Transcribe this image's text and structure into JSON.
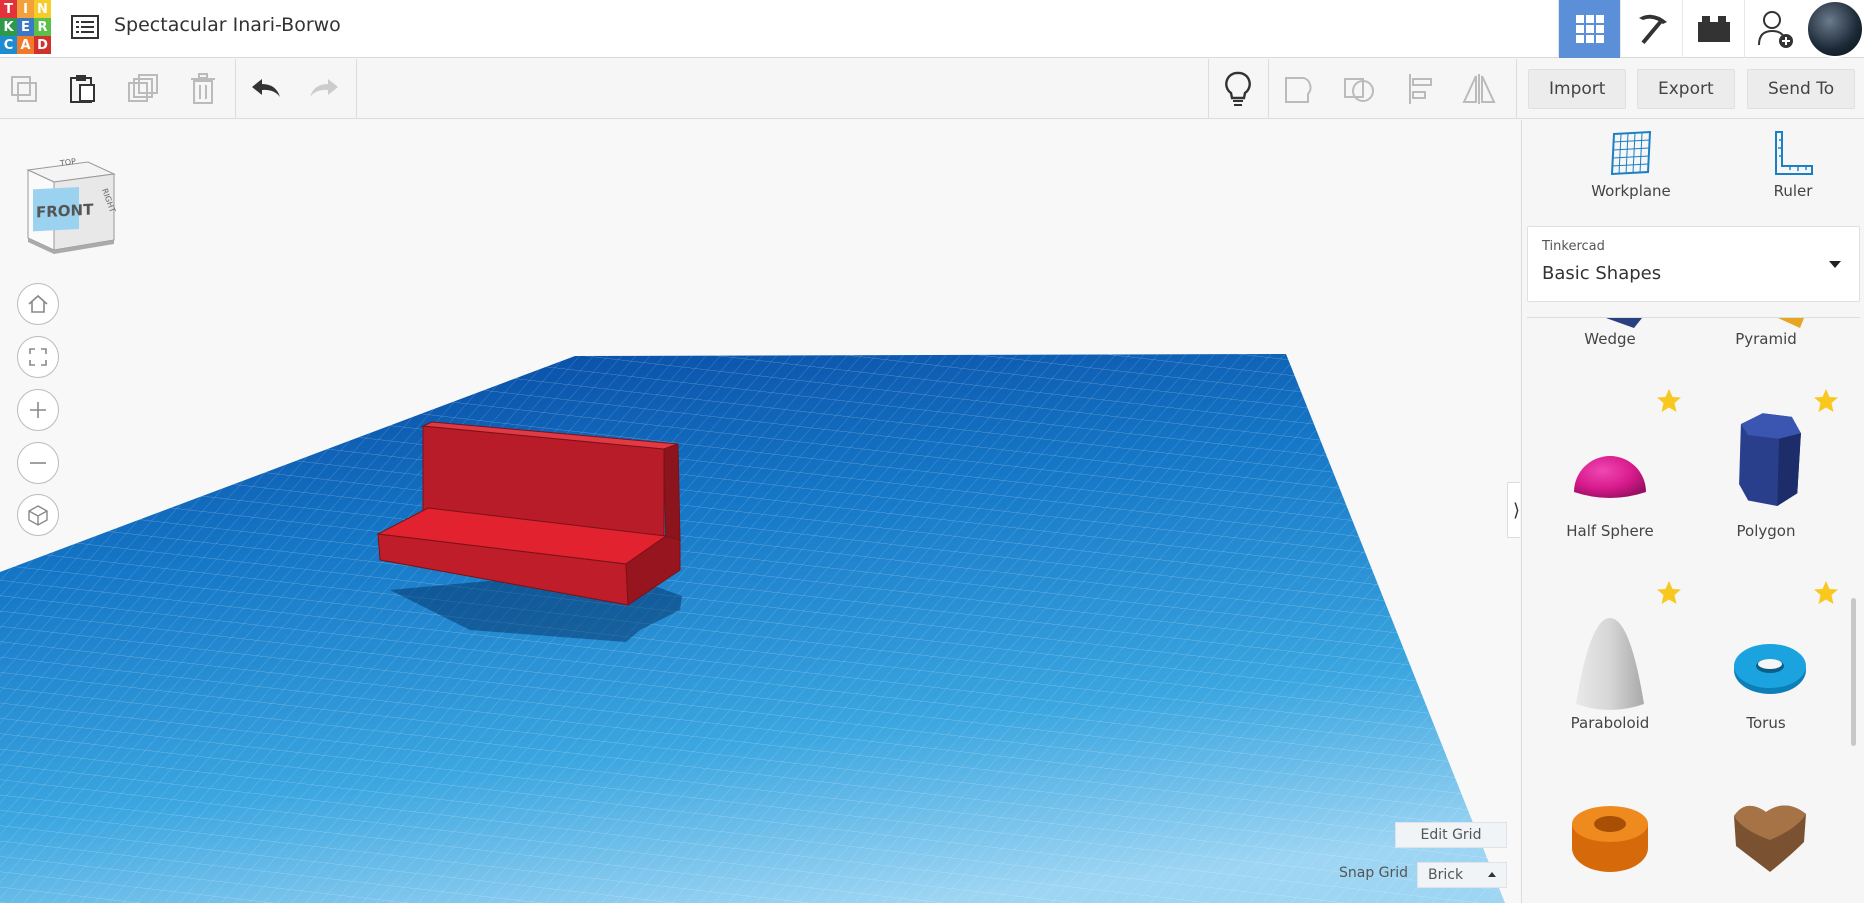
{
  "header": {
    "logo_letters": [
      "T",
      "I",
      "N",
      "K",
      "E",
      "R",
      "C",
      "A",
      "D"
    ],
    "logo_colors": [
      "#e2323b",
      "#f2a03a",
      "#f5cc2a",
      "#2e9a49",
      "#3b78c6",
      "#5bbf4a",
      "#1f8bd0",
      "#ef7b2a",
      "#d0312d"
    ],
    "design_title": "Spectacular Inari-Borwo",
    "icons": [
      "grid-view-icon",
      "pickaxe-icon",
      "bricks-icon",
      "add-user-icon"
    ]
  },
  "toolbar": {
    "import_label": "Import",
    "export_label": "Export",
    "send_to_label": "Send To"
  },
  "viewcube": {
    "front_label": "FRONT",
    "top_label": "TOP",
    "side_label": "RIGHT"
  },
  "workspace": {
    "edit_grid_label": "Edit Grid",
    "snap_grid_label": "Snap Grid",
    "snap_grid_value": "Brick",
    "accent_color": "#1b8fd6"
  },
  "panel": {
    "tools": [
      {
        "label": "Workplane"
      },
      {
        "label": "Ruler"
      }
    ],
    "library_source": "Tinkercad",
    "library_name": "Basic Shapes",
    "shapes": [
      {
        "label": "Wedge",
        "favorite": false
      },
      {
        "label": "Pyramid",
        "favorite": false
      },
      {
        "label": "Half Sphere",
        "favorite": true
      },
      {
        "label": "Polygon",
        "favorite": true
      },
      {
        "label": "Paraboloid",
        "favorite": true
      },
      {
        "label": "Torus",
        "favorite": true
      },
      {
        "label": "",
        "favorite": false
      },
      {
        "label": "",
        "favorite": false
      }
    ]
  }
}
